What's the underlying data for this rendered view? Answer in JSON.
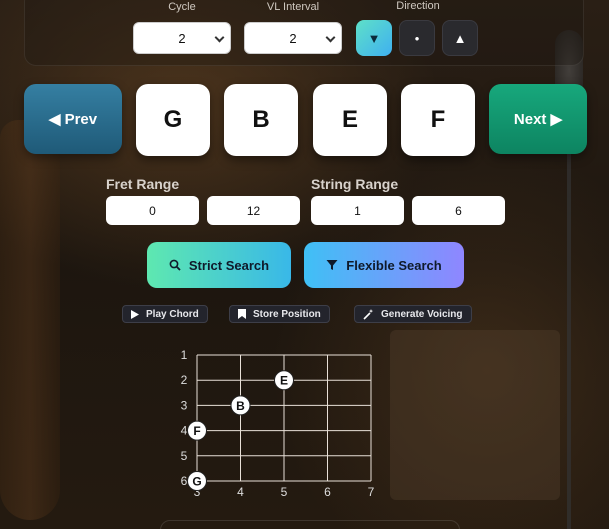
{
  "controls": {
    "cycle": {
      "label": "Cycle",
      "value": "2"
    },
    "vl_interval": {
      "label": "VL Interval",
      "value": "2"
    },
    "direction": {
      "label": "Direction",
      "buttons": [
        {
          "glyph": "▼",
          "icon": "arrow-down-icon",
          "active": true
        },
        {
          "glyph": "•",
          "icon": "dot-icon",
          "active": false
        },
        {
          "glyph": "▲",
          "icon": "arrow-up-icon",
          "active": false
        }
      ]
    }
  },
  "nav": {
    "prev_label": "◀ Prev",
    "next_label": "Next ▶"
  },
  "chord_notes": [
    "G",
    "B",
    "E",
    "F"
  ],
  "fret_range": {
    "label": "Fret Range",
    "min": "0",
    "max": "12"
  },
  "string_range": {
    "label": "String Range",
    "min": "1",
    "max": "6"
  },
  "search": {
    "strict_label": "Strict Search",
    "flexible_label": "Flexible Search"
  },
  "actions": {
    "play_label": "Play Chord",
    "store_label": "Store Position",
    "generate_label": "Generate Voicing"
  },
  "fretboard": {
    "string_labels": [
      "1",
      "2",
      "3",
      "4",
      "5",
      "6"
    ],
    "fret_labels": [
      "3",
      "4",
      "5",
      "6",
      "7"
    ],
    "notes": [
      {
        "name": "E",
        "string": 2,
        "fret": 5
      },
      {
        "name": "B",
        "string": 3,
        "fret": 4
      },
      {
        "name": "F",
        "string": 4,
        "fret": 3
      },
      {
        "name": "G",
        "string": 6,
        "fret": 3
      }
    ]
  },
  "colors": {
    "prev_bg": "#2b6f8f",
    "next_bg": "#12966e",
    "strict_gradient": [
      "#5ee8b0",
      "#39b8e8"
    ],
    "flexible_gradient": [
      "#3fc0f5",
      "#8f86ff"
    ]
  }
}
